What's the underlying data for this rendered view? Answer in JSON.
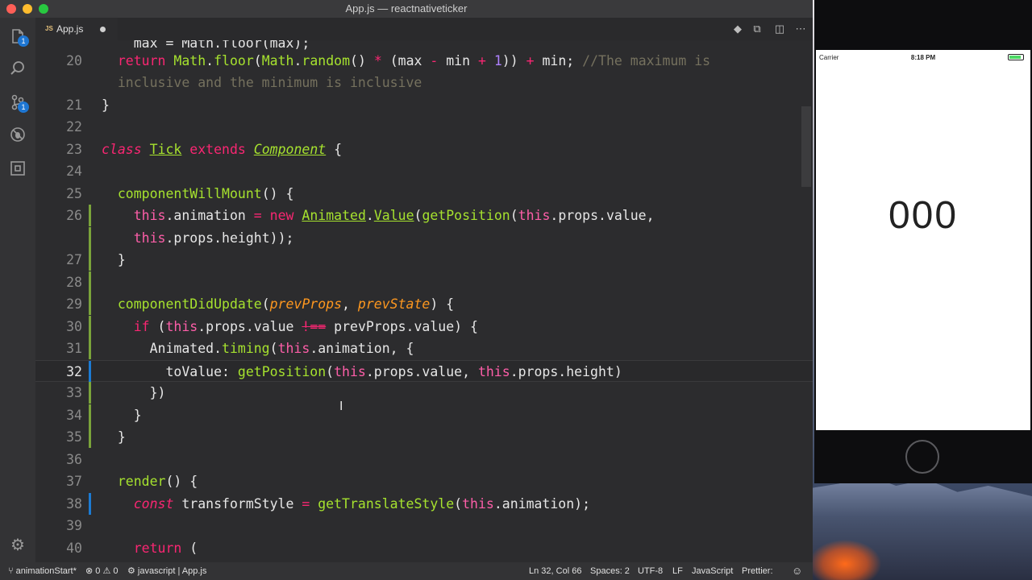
{
  "window": {
    "title": "App.js — reactnativeticker"
  },
  "tabs": [
    {
      "type_tag": "JS",
      "label": "App.js",
      "dirty": true
    }
  ],
  "activity_bar": {
    "badges": {
      "explorer": "1",
      "source_control": "1"
    },
    "icons": [
      "files-icon",
      "search-icon",
      "source-control-icon",
      "debug-icon",
      "extensions-icon",
      "settings-gear-icon"
    ]
  },
  "editor": {
    "lines": [
      {
        "num": "",
        "tokens": [
          {
            "t": "    max = Math.floor(max);",
            "c": ""
          }
        ]
      },
      {
        "num": "20",
        "tokens": [
          {
            "t": "  ",
            "c": ""
          },
          {
            "t": "return",
            "c": "kw"
          },
          {
            "t": " ",
            "c": ""
          },
          {
            "t": "Math",
            "c": "fn"
          },
          {
            "t": ".",
            "c": ""
          },
          {
            "t": "floor",
            "c": "fn"
          },
          {
            "t": "(",
            "c": ""
          },
          {
            "t": "Math",
            "c": "fn"
          },
          {
            "t": ".",
            "c": ""
          },
          {
            "t": "random",
            "c": "fn"
          },
          {
            "t": "() ",
            "c": ""
          },
          {
            "t": "*",
            "c": "op"
          },
          {
            "t": " (max ",
            "c": ""
          },
          {
            "t": "-",
            "c": "op"
          },
          {
            "t": " min ",
            "c": ""
          },
          {
            "t": "+",
            "c": "op"
          },
          {
            "t": " ",
            "c": ""
          },
          {
            "t": "1",
            "c": "num"
          },
          {
            "t": ")) ",
            "c": ""
          },
          {
            "t": "+",
            "c": "op"
          },
          {
            "t": " min; ",
            "c": ""
          },
          {
            "t": "//The maximum is",
            "c": "cmt"
          }
        ]
      },
      {
        "num": "",
        "tokens": [
          {
            "t": "  ",
            "c": ""
          },
          {
            "t": "inclusive and the minimum is inclusive",
            "c": "cmt"
          }
        ]
      },
      {
        "num": "21",
        "tokens": [
          {
            "t": "}",
            "c": ""
          }
        ]
      },
      {
        "num": "22",
        "tokens": []
      },
      {
        "num": "23",
        "tokens": [
          {
            "t": "class",
            "c": "kwi"
          },
          {
            "t": " ",
            "c": ""
          },
          {
            "t": "Tick",
            "c": "cls"
          },
          {
            "t": " ",
            "c": ""
          },
          {
            "t": "extends",
            "c": "kw"
          },
          {
            "t": " ",
            "c": ""
          },
          {
            "t": "Component",
            "c": "clsi"
          },
          {
            "t": " {",
            "c": ""
          }
        ]
      },
      {
        "num": "24",
        "tokens": []
      },
      {
        "num": "25",
        "tokens": [
          {
            "t": "  ",
            "c": ""
          },
          {
            "t": "componentWillMount",
            "c": "fn"
          },
          {
            "t": "() {",
            "c": ""
          }
        ]
      },
      {
        "num": "26",
        "tokens": [
          {
            "t": "    ",
            "c": ""
          },
          {
            "t": "this",
            "c": "this"
          },
          {
            "t": ".animation ",
            "c": ""
          },
          {
            "t": "=",
            "c": "op"
          },
          {
            "t": " ",
            "c": ""
          },
          {
            "t": "new",
            "c": "kw"
          },
          {
            "t": " ",
            "c": ""
          },
          {
            "t": "Animated",
            "c": "cls"
          },
          {
            "t": ".",
            "c": ""
          },
          {
            "t": "Value",
            "c": "cls"
          },
          {
            "t": "(",
            "c": ""
          },
          {
            "t": "getPosition",
            "c": "fn"
          },
          {
            "t": "(",
            "c": ""
          },
          {
            "t": "this",
            "c": "this"
          },
          {
            "t": ".props.value,",
            "c": ""
          }
        ]
      },
      {
        "num": "",
        "tokens": [
          {
            "t": "    ",
            "c": ""
          },
          {
            "t": "this",
            "c": "this"
          },
          {
            "t": ".props.height));",
            "c": ""
          }
        ]
      },
      {
        "num": "27",
        "tokens": [
          {
            "t": "  }",
            "c": ""
          }
        ]
      },
      {
        "num": "28",
        "tokens": []
      },
      {
        "num": "29",
        "tokens": [
          {
            "t": "  ",
            "c": ""
          },
          {
            "t": "componentDidUpdate",
            "c": "fn"
          },
          {
            "t": "(",
            "c": ""
          },
          {
            "t": "prevProps",
            "c": "param"
          },
          {
            "t": ", ",
            "c": ""
          },
          {
            "t": "prevState",
            "c": "param"
          },
          {
            "t": ") {",
            "c": ""
          }
        ]
      },
      {
        "num": "30",
        "tokens": [
          {
            "t": "    ",
            "c": ""
          },
          {
            "t": "if",
            "c": "kw"
          },
          {
            "t": " (",
            "c": ""
          },
          {
            "t": "this",
            "c": "this"
          },
          {
            "t": ".props.value ",
            "c": ""
          },
          {
            "t": "!==",
            "c": "strike"
          },
          {
            "t": " prevProps.value) {",
            "c": ""
          }
        ]
      },
      {
        "num": "31",
        "tokens": [
          {
            "t": "      Animated.",
            "c": ""
          },
          {
            "t": "timing",
            "c": "fn"
          },
          {
            "t": "(",
            "c": ""
          },
          {
            "t": "this",
            "c": "this"
          },
          {
            "t": ".animation, {",
            "c": ""
          }
        ]
      },
      {
        "num": "32",
        "tokens": [
          {
            "t": "        toValue: ",
            "c": ""
          },
          {
            "t": "getPosition",
            "c": "fn"
          },
          {
            "t": "(",
            "c": ""
          },
          {
            "t": "this",
            "c": "this"
          },
          {
            "t": ".props.value, ",
            "c": ""
          },
          {
            "t": "this",
            "c": "this"
          },
          {
            "t": ".props.height)",
            "c": ""
          }
        ]
      },
      {
        "num": "33",
        "tokens": [
          {
            "t": "      })",
            "c": ""
          }
        ]
      },
      {
        "num": "34",
        "tokens": [
          {
            "t": "    }",
            "c": ""
          }
        ]
      },
      {
        "num": "35",
        "tokens": [
          {
            "t": "  }",
            "c": ""
          }
        ]
      },
      {
        "num": "36",
        "tokens": []
      },
      {
        "num": "37",
        "tokens": [
          {
            "t": "  ",
            "c": ""
          },
          {
            "t": "render",
            "c": "fn"
          },
          {
            "t": "() {",
            "c": ""
          }
        ]
      },
      {
        "num": "38",
        "tokens": [
          {
            "t": "    ",
            "c": ""
          },
          {
            "t": "const",
            "c": "kwi"
          },
          {
            "t": " transformStyle ",
            "c": ""
          },
          {
            "t": "=",
            "c": "op"
          },
          {
            "t": " ",
            "c": ""
          },
          {
            "t": "getTranslateStyle",
            "c": "fn"
          },
          {
            "t": "(",
            "c": ""
          },
          {
            "t": "this",
            "c": "this"
          },
          {
            "t": ".animation);",
            "c": ""
          }
        ]
      },
      {
        "num": "39",
        "tokens": []
      },
      {
        "num": "40",
        "tokens": [
          {
            "t": "    ",
            "c": ""
          },
          {
            "t": "return",
            "c": "kw"
          },
          {
            "t": " (",
            "c": ""
          }
        ]
      }
    ],
    "current_line": "32"
  },
  "statusbar": {
    "branch": "animationStart*",
    "errors": "0",
    "warnings": "0",
    "language_scope": "javascript",
    "file": "App.js",
    "position": "Ln 32, Col 66",
    "spaces": "Spaces: 2",
    "encoding": "UTF-8",
    "eol": "LF",
    "language": "JavaScript",
    "formatter": "Prettier: "
  },
  "simulator": {
    "carrier": "Carrier",
    "time": "8:18 PM",
    "ticker_value": "000",
    "battery_level": 0.9
  }
}
